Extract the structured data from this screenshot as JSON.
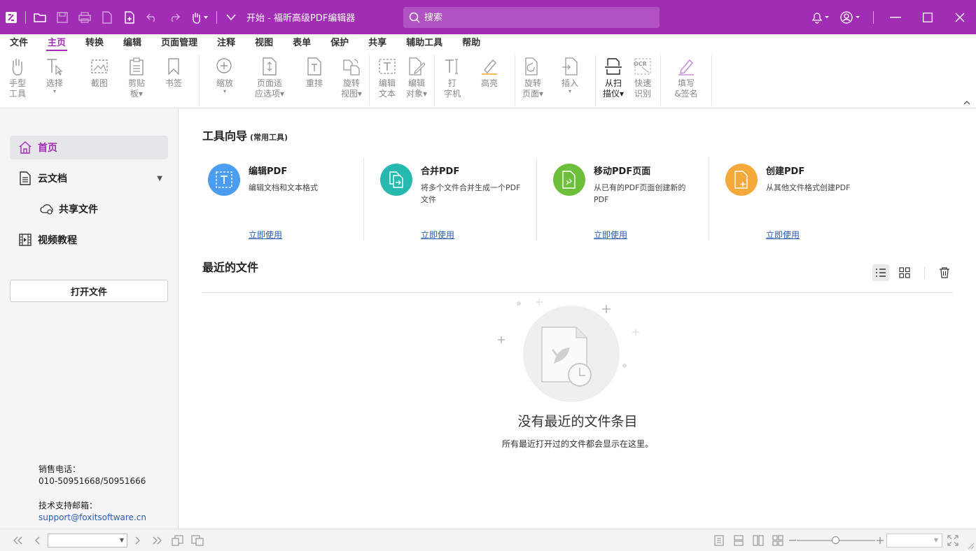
{
  "window": {
    "title": "开始 - 福昕高级PDF编辑器",
    "search_placeholder": "搜索"
  },
  "menu": {
    "tabs": [
      "文件",
      "主页",
      "转换",
      "编辑",
      "页面管理",
      "注释",
      "视图",
      "表单",
      "保护",
      "共享",
      "辅助工具",
      "帮助"
    ],
    "active_tab": "主页"
  },
  "ribbon": {
    "hand": "手型\n工具",
    "select": "选择",
    "screenshot": "截图",
    "clipboard": "剪贴\n板▾",
    "bookmark": "书签",
    "zoom": "缩放",
    "fit_page": "页面适\n应选项▾",
    "reflow": "重排",
    "rotate_view": "旋转\n视图▾",
    "edit_text": "编辑\n文本",
    "edit_object": "编辑\n对象▾",
    "typewriter": "打\n字机",
    "highlight": "高亮",
    "rotate_page": "旋转\n页面▾",
    "insert": "插入",
    "from_scanner": "从扫\n描仪▾",
    "quick_ocr": "快速\n识别",
    "fill_sign": "填写\n&签名",
    "ocr_badge": "OCR"
  },
  "sidebar": {
    "home": "首页",
    "cloud_docs": "云文档",
    "shared_files": "共享文件",
    "video_tutorials": "视频教程",
    "open_file": "打开文件",
    "sales_label": "销售电话：",
    "sales_phone": "010-50951668/50951666",
    "support_label": "技术支持邮箱：",
    "support_email": "support@foxitsoftware.cn"
  },
  "tools_section": {
    "title": "工具向导",
    "subtitle": "(常用工具)",
    "cards": [
      {
        "name": "编辑PDF",
        "desc": "编辑文档和文本格式",
        "link": "立即使用",
        "color": "#4a9df0"
      },
      {
        "name": "合并PDF",
        "desc": "将多个文件合并生成一个PDF文件",
        "link": "立即使用",
        "color": "#27b8b0"
      },
      {
        "name": "移动PDF页面",
        "desc": "从已有的PDF页面创建新的PDF",
        "link": "立即使用",
        "color": "#6dbf3b"
      },
      {
        "name": "创建PDF",
        "desc": "从其他文件格式创建PDF",
        "link": "立即使用",
        "color": "#f5a93b"
      }
    ]
  },
  "recent_section": {
    "title": "最近的文件",
    "empty_title": "没有最近的文件条目",
    "empty_sub": "所有最近打开过的文件都会显示在这里。"
  },
  "colors": {
    "brand": "#a22db5",
    "link": "#2a5db0"
  }
}
